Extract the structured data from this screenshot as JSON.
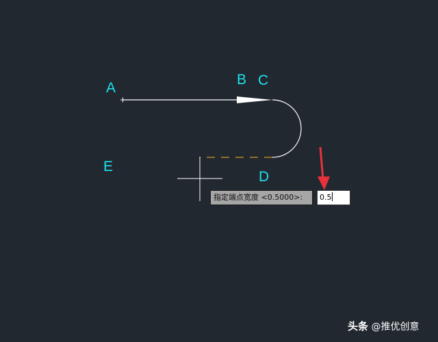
{
  "drawing": {
    "point_labels": {
      "a": "A",
      "b": "B",
      "c": "C",
      "d": "D",
      "e": "E"
    },
    "colors": {
      "background": "#212830",
      "label": "#1fe1ef",
      "polyline": "#ffffff",
      "rubber_band": "#d59a2e",
      "crosshair": "#ffffff",
      "pointer_arrow": "#e8323a"
    }
  },
  "command_prompt": {
    "text": "指定端点宽度 <0.5000>:",
    "input_value": "0.5"
  },
  "watermark": {
    "logo": "头条",
    "text": "@推优创意"
  }
}
